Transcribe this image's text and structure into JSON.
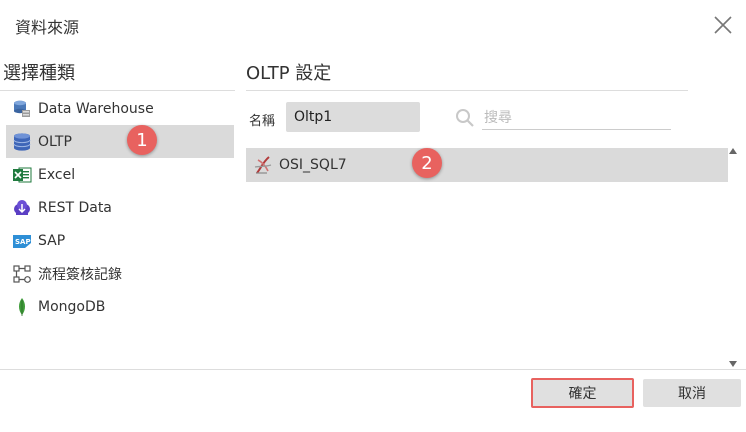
{
  "dialog": {
    "title": "資料來源"
  },
  "left": {
    "title": "選擇種類",
    "items": [
      {
        "label": "Data Warehouse",
        "icon": "data-warehouse-icon"
      },
      {
        "label": "OLTP",
        "icon": "database-icon",
        "selected": true
      },
      {
        "label": "Excel",
        "icon": "excel-icon"
      },
      {
        "label": "REST Data",
        "icon": "rest-data-icon"
      },
      {
        "label": "SAP",
        "icon": "sap-icon"
      },
      {
        "label": "流程簽核記錄",
        "icon": "workflow-icon"
      },
      {
        "label": "MongoDB",
        "icon": "mongodb-leaf-icon"
      }
    ]
  },
  "right": {
    "title": "OLTP 設定",
    "name_label": "名稱",
    "name_value": "Oltp1",
    "search_placeholder": "搜尋",
    "sources": [
      {
        "label": "OSI_SQL7",
        "icon": "sql-server-icon",
        "selected": true
      }
    ]
  },
  "badges": {
    "one": "1",
    "two": "2"
  },
  "buttons": {
    "ok": "確定",
    "cancel": "取消"
  },
  "colors": {
    "accent": "#e8625f",
    "selection": "#dadada"
  }
}
